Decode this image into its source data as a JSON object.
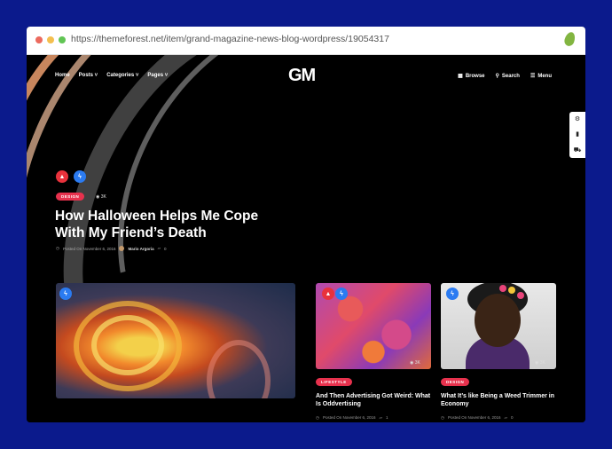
{
  "browser": {
    "url": "https://themeforest.net/item/grand-magazine-news-blog-wordpress/19054317"
  },
  "nav": {
    "left": [
      "Home",
      "Posts",
      "Categories",
      "Pages"
    ],
    "logo": "GM",
    "right": [
      {
        "icon": "grid-icon",
        "label": "Browse"
      },
      {
        "icon": "search-icon",
        "label": "Search"
      },
      {
        "icon": "hamburger-icon",
        "label": "Menu"
      }
    ]
  },
  "hero": {
    "category": "DESIGN",
    "views": "3K",
    "title": "How Halloween Helps Me Cope With My Friend’s Death",
    "posted": "Posted On November 6, 2016",
    "author": "Mario Argoria",
    "comments": "0"
  },
  "cards": [
    {
      "category": "LIFESTYLE",
      "views": "3K",
      "title": "And Then Advertising Got Weird: What Is Oddvertising",
      "posted": "Posted On November 6, 2016",
      "comments": "1"
    },
    {
      "category": "DESIGN",
      "views": "3K",
      "title": "What It’s like Being a Weed Trimmer in Economy",
      "posted": "Posted On November 6, 2016",
      "comments": "0"
    }
  ],
  "colors": {
    "accent": "#e7314d",
    "blue": "#2b7bf1",
    "frame": "#0b1a8c"
  }
}
